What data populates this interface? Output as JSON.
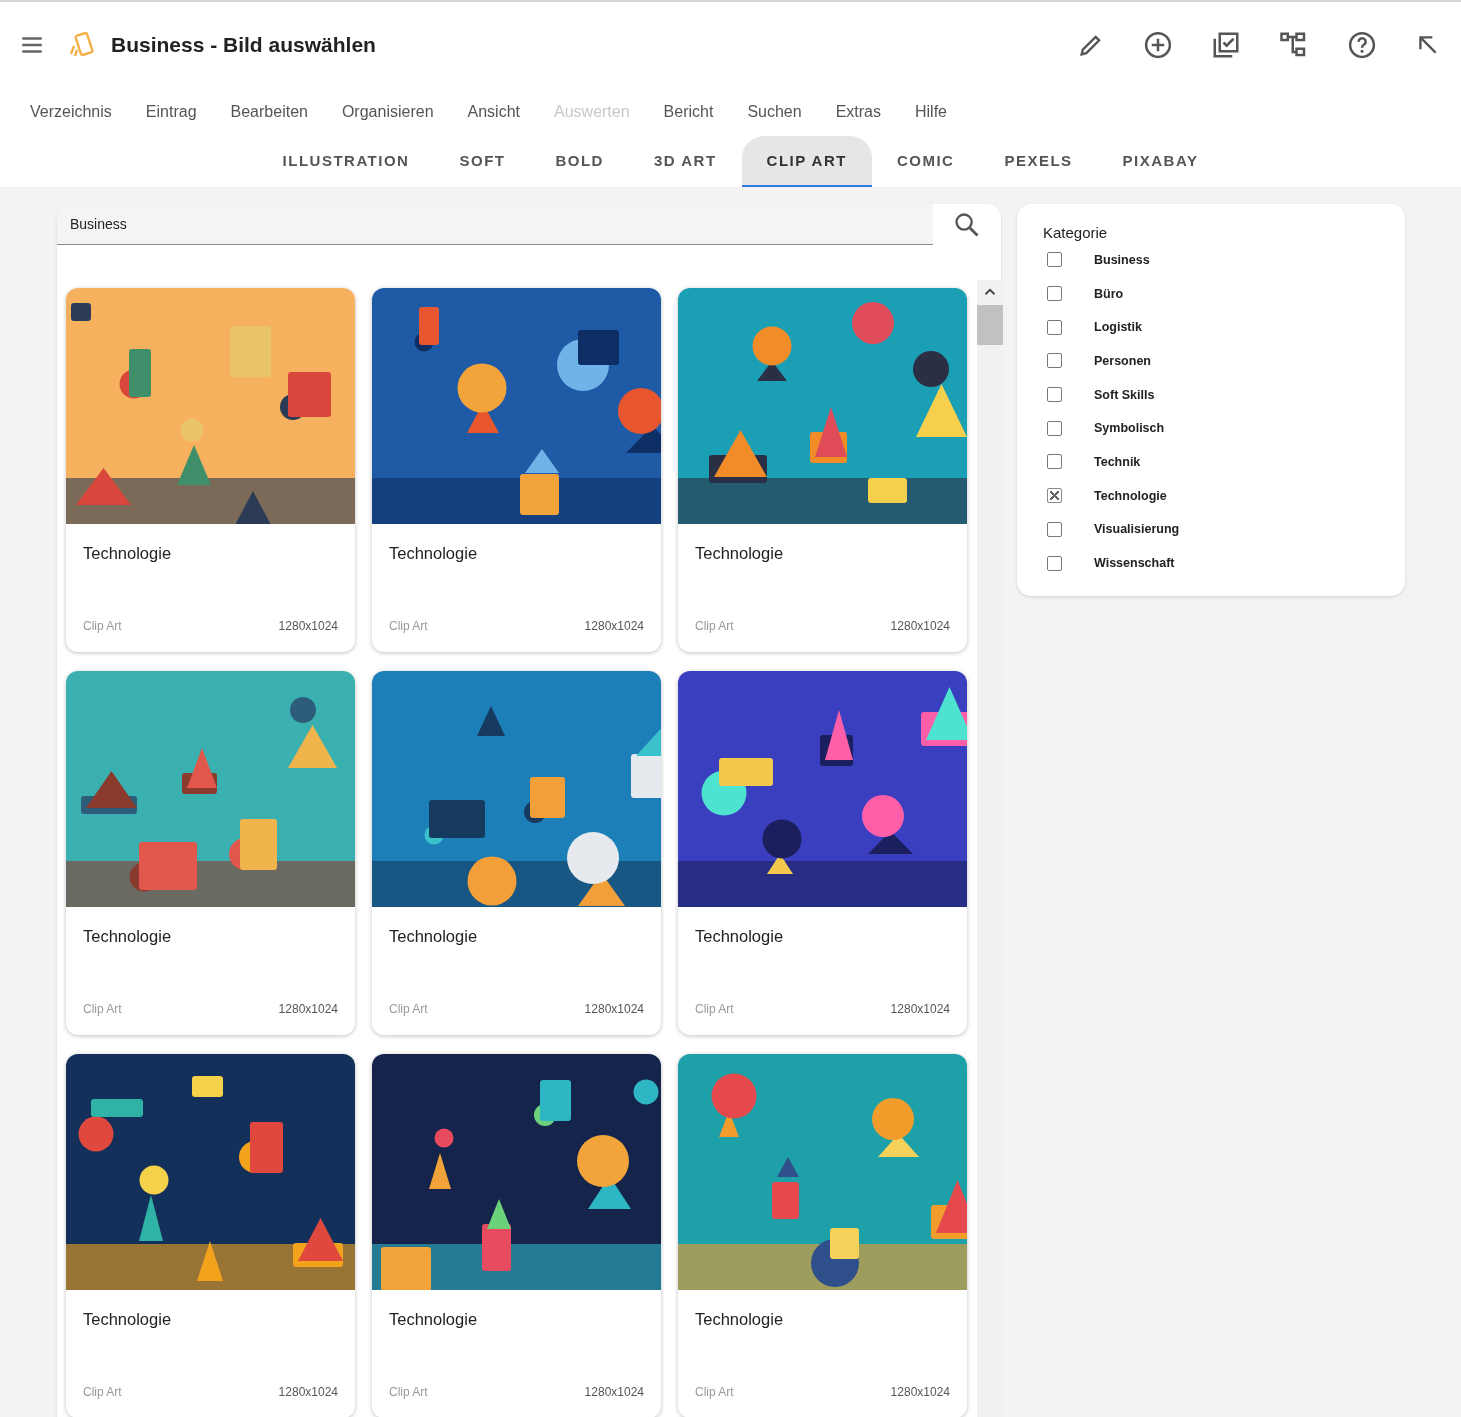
{
  "window": {
    "title": "Business - Bild auswählen"
  },
  "menu": [
    {
      "label": "Verzeichnis",
      "disabled": false
    },
    {
      "label": "Eintrag",
      "disabled": false
    },
    {
      "label": "Bearbeiten",
      "disabled": false
    },
    {
      "label": "Organisieren",
      "disabled": false
    },
    {
      "label": "Ansicht",
      "disabled": false
    },
    {
      "label": "Auswerten",
      "disabled": true
    },
    {
      "label": "Bericht",
      "disabled": false
    },
    {
      "label": "Suchen",
      "disabled": false
    },
    {
      "label": "Extras",
      "disabled": false
    },
    {
      "label": "Hilfe",
      "disabled": false
    }
  ],
  "tabs": [
    {
      "label": "ILLUSTRATION",
      "selected": false
    },
    {
      "label": "SOFT",
      "selected": false
    },
    {
      "label": "BOLD",
      "selected": false
    },
    {
      "label": "3D ART",
      "selected": false
    },
    {
      "label": "CLIP ART",
      "selected": true
    },
    {
      "label": "COMIC",
      "selected": false
    },
    {
      "label": "PEXELS",
      "selected": false
    },
    {
      "label": "PIXABAY",
      "selected": false
    }
  ],
  "search": {
    "value": "Business"
  },
  "cards": [
    {
      "title": "Technologie",
      "style": "Clip Art",
      "size": "1280x1024"
    },
    {
      "title": "Technologie",
      "style": "Clip Art",
      "size": "1280x1024"
    },
    {
      "title": "Technologie",
      "style": "Clip Art",
      "size": "1280x1024"
    },
    {
      "title": "Technologie",
      "style": "Clip Art",
      "size": "1280x1024"
    },
    {
      "title": "Technologie",
      "style": "Clip Art",
      "size": "1280x1024"
    },
    {
      "title": "Technologie",
      "style": "Clip Art",
      "size": "1280x1024"
    },
    {
      "title": "Technologie",
      "style": "Clip Art",
      "size": "1280x1024"
    },
    {
      "title": "Technologie",
      "style": "Clip Art",
      "size": "1280x1024"
    },
    {
      "title": "Technologie",
      "style": "Clip Art",
      "size": "1280x1024"
    }
  ],
  "filter": {
    "title": "Kategorie",
    "items": [
      {
        "label": "Business",
        "checked": false
      },
      {
        "label": "Büro",
        "checked": false
      },
      {
        "label": "Logistik",
        "checked": false
      },
      {
        "label": "Personen",
        "checked": false
      },
      {
        "label": "Soft Skills",
        "checked": false
      },
      {
        "label": "Symbolisch",
        "checked": false
      },
      {
        "label": "Technik",
        "checked": false
      },
      {
        "label": "Technologie",
        "checked": true
      },
      {
        "label": "Visualisierung",
        "checked": false
      },
      {
        "label": "Wissenschaft",
        "checked": false
      }
    ]
  }
}
